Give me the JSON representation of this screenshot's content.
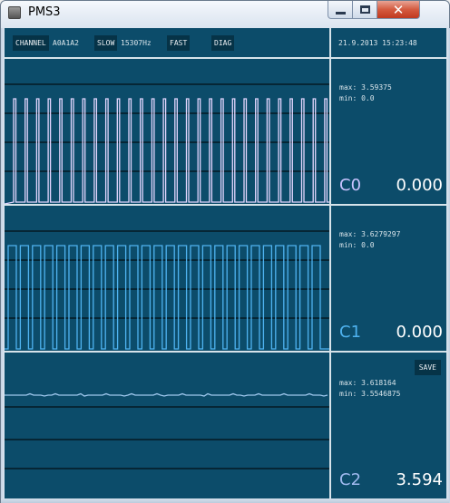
{
  "window": {
    "title": "PMS3",
    "icon": "app-icon",
    "close_glyph": "✕"
  },
  "toolbar": {
    "channel_label": "CHANNEL",
    "channel_value": "A0A1A2",
    "slow_label": "SLOW",
    "rate": "15307Hz",
    "fast_label": "FAST",
    "diag_label": "DIAG",
    "datetime": "21.9.2013 15:23:48"
  },
  "channels": [
    {
      "name": "C0",
      "max": "max: 3.59375",
      "min": "min: 0.0",
      "value": "0.000",
      "color": "#c9c3ff",
      "trace_color": "#e3d6ff"
    },
    {
      "name": "C1",
      "max": "max: 3.6279297",
      "min": "min: 0.0",
      "value": "0.000",
      "color": "#4fb3f0",
      "trace_color": "#4fb3f0"
    },
    {
      "name": "C2",
      "max": "max: 3.618164",
      "min": "min: 3.5546875",
      "value": "3.594",
      "color": "#9fb9ee",
      "trace_color": "#9fc8ee"
    }
  ],
  "save_label": "SAVE",
  "colors": {
    "background": "#0c4c6a",
    "divider": "#d6e3ea",
    "button_bg": "#063347"
  }
}
